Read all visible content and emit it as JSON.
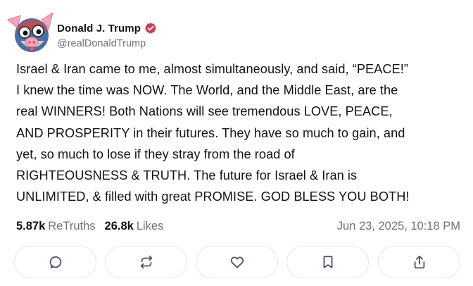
{
  "author": {
    "name": "Donald J. Trump",
    "handle": "@realDonaldTrump",
    "avatar": "cartoon-pig-face-avatar",
    "verified_badge": "verified-check-icon",
    "accent_color": "#c5415a"
  },
  "post": {
    "text": "Israel & Iran came to me, almost simultaneously, and said, “PEACE!”\nI knew the time was NOW. The World, and the Middle East, are the\nreal WINNERS! Both Nations will see tremendous LOVE, PEACE,\nAND PROSPERITY in their futures. They have so much to gain, and\nyet, so much to lose if they stray from the road of\nRIGHTEOUSNESS & TRUTH. The future for Israel & Iran is\nUNLIMITED, & filled with great PROMISE. GOD BLESS YOU BOTH!"
  },
  "stats": {
    "retruths_count": "5.87k",
    "retruths_label": "ReTruths",
    "likes_count": "26.8k",
    "likes_label": "Likes",
    "timestamp": "Jun 23, 2025, 10:18 PM"
  },
  "actions": [
    {
      "name": "reply",
      "icon": "speech-bubble-icon"
    },
    {
      "name": "retruth",
      "icon": "repost-arrows-icon"
    },
    {
      "name": "like",
      "icon": "heart-icon"
    },
    {
      "name": "bookmark",
      "icon": "bookmark-icon"
    },
    {
      "name": "share",
      "icon": "share-upload-icon"
    }
  ]
}
